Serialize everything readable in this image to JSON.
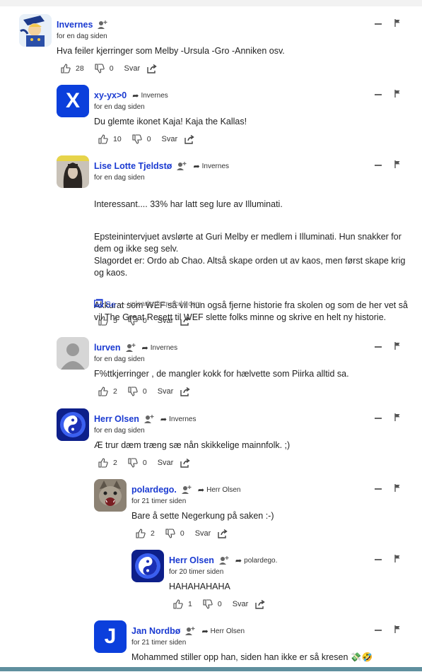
{
  "comments": [
    {
      "author": "Invernes",
      "reply_to": "",
      "time": "for en dag siden",
      "body": [
        "Hva feiler kjerringer som Melby -Ursula -Gro -Anniken osv."
      ],
      "likes": "28",
      "dislikes": "0",
      "reply_label": "Svar",
      "avatar": "avatar-cartoon"
    },
    {
      "author": "xy-yx>0",
      "reply_to": "Invernes",
      "time": "for en dag siden",
      "body": [
        "Du glemte ikonet Kaja! Kaja the Kallas!"
      ],
      "likes": "10",
      "dislikes": "0",
      "reply_label": "Svar",
      "avatar_letter": "X"
    },
    {
      "author": "Lise Lotte Tjeldstø",
      "reply_to": "Invernes",
      "time": "for en dag siden",
      "body": [
        "Interessant.... 33% har latt seg lure av Illuminati.",
        "Epsteinintervjuet avslørte at Guri Melby er medlem i Illuminati. Hun snakker for dem og ikke seg selv.\nSlagordet er: Ordo ab Chao. Altså skape orden ut av kaos, men først skape krig og kaos.",
        "Akkurat som WEF så vil hun også fjerne historie fra skolen og som de her vet så vil The Great Resett til WEF slette folks minne og skrive en helt ny historie."
      ],
      "link_label": "Se",
      "link_source": "— uploads.disquscdn.com",
      "likes": "5",
      "dislikes": "0",
      "reply_label": "Svar",
      "avatar": "avatar-photo"
    },
    {
      "author": "lurven",
      "reply_to": "Invernes",
      "time": "for en dag siden",
      "body": [
        "F%ttkjerringer , de mangler kokk for hælvette som Piirka alltid sa."
      ],
      "likes": "2",
      "dislikes": "0",
      "reply_label": "Svar",
      "avatar": "avatar-default"
    },
    {
      "author": "Herr Olsen",
      "reply_to": "Invernes",
      "time": "for en dag siden",
      "body": [
        "Æ trur dæm træng sæ nån skikkelige mainnfolk. ;)"
      ],
      "likes": "2",
      "dislikes": "0",
      "reply_label": "Svar",
      "avatar": "avatar-yinyang"
    },
    {
      "author": "polardego.",
      "reply_to": "Herr Olsen",
      "time": "for 21 timer siden",
      "body": [
        "Bare å sette Negerkung på saken :-)"
      ],
      "likes": "2",
      "dislikes": "0",
      "reply_label": "Svar",
      "avatar": "avatar-cat"
    },
    {
      "author": "Herr Olsen",
      "reply_to": "polardego.",
      "time": "for 20 timer siden",
      "body": [
        "HAHAHAHAHA"
      ],
      "likes": "1",
      "dislikes": "0",
      "reply_label": "Svar",
      "avatar": "avatar-yinyang"
    },
    {
      "author": "Jan Nordbø",
      "reply_to": "Herr Olsen",
      "time": "for 21 timer siden",
      "body": [
        "Mohammed stiller opp han, siden han ikke er så kresen 💸🤣"
      ],
      "avatar_letter": "J"
    }
  ],
  "colors": {
    "author": "#1a3ad1",
    "avatar_blue": "#0b3fdc",
    "bottom_bar": "#5f8f9e"
  }
}
